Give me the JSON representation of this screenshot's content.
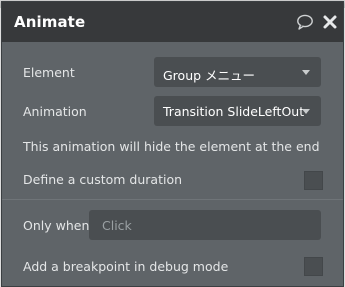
{
  "dialog": {
    "title": "Animate",
    "header_icons": [
      "comment-icon",
      "close-icon"
    ]
  },
  "fields": {
    "element": {
      "label": "Element",
      "value": "Group メニュー"
    },
    "animation": {
      "label": "Animation",
      "value": "Transition SlideLeftOut"
    },
    "info_text": "This animation will hide the element at the end",
    "custom_duration": {
      "label": "Define a custom duration",
      "checked": false
    },
    "only_when": {
      "label": "Only when",
      "placeholder": "Click"
    },
    "breakpoint": {
      "label": "Add a breakpoint in debug mode",
      "checked": false
    }
  },
  "colors": {
    "panel_bg": "#5f6468",
    "header_bg": "#37393b",
    "control_bg": "#4a4e51"
  }
}
